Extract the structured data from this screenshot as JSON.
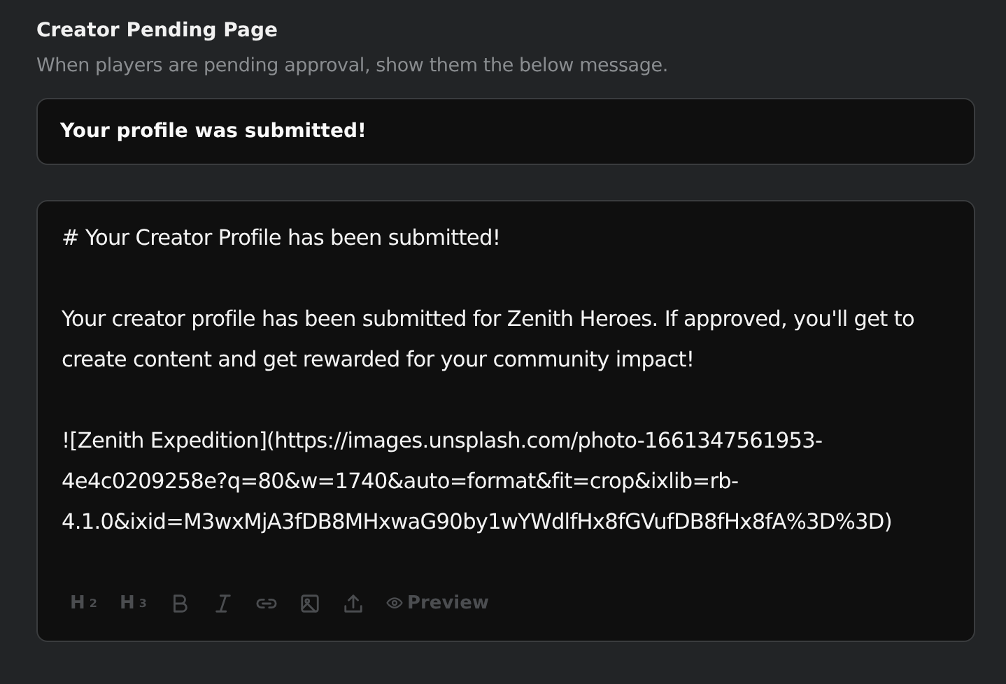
{
  "section": {
    "title": "Creator Pending Page",
    "description": "When players are pending approval, show them the below message."
  },
  "heading_field": {
    "value": "Your profile was submitted!"
  },
  "message_editor": {
    "value": "# Your Creator Profile has been submitted!\n\nYour creator profile has been submitted for Zenith Heroes. If approved, you'll get to create content and get rewarded for your community impact!\n\n![Zenith Expedition](https://images.unsplash.com/photo-1661347561953-4e4c0209258e?q=80&w=1740&auto=format&fit=crop&ixlib=rb-4.1.0&ixid=M3wxMjA3fDB8MHxwaG90by1wYWdlfHx8fGVufDB8fHx8fA%3D%3D)",
    "toolbar": [
      {
        "kind": "heading",
        "label": "H",
        "sub": "2"
      },
      {
        "kind": "heading",
        "label": "H",
        "sub": "3"
      },
      {
        "kind": "bold"
      },
      {
        "kind": "italic"
      },
      {
        "kind": "link"
      },
      {
        "kind": "image"
      },
      {
        "kind": "upload"
      },
      {
        "kind": "preview",
        "label": "Preview"
      }
    ]
  }
}
